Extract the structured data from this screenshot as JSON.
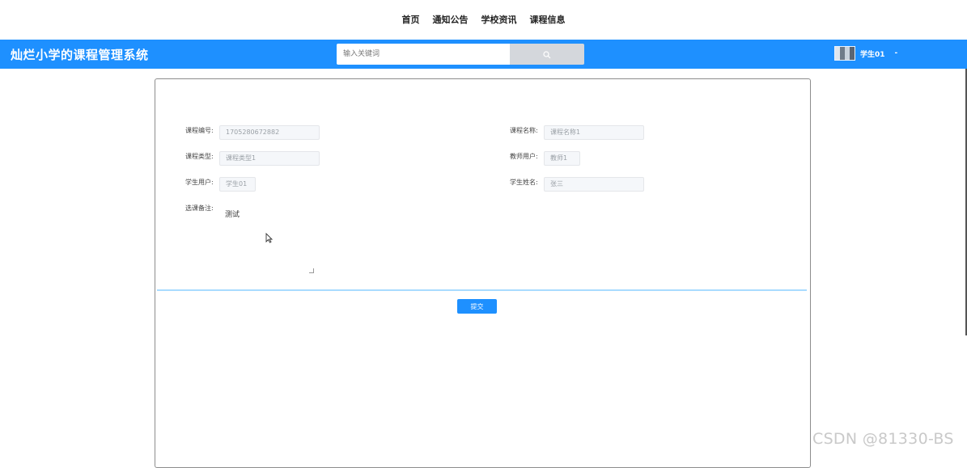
{
  "nav": {
    "items": [
      "首页",
      "通知公告",
      "学校资讯",
      "课程信息"
    ]
  },
  "header": {
    "title": "灿烂小学的课程管理系统",
    "search": {
      "placeholder": "输入关键词",
      "value": "",
      "icon": "search-icon"
    },
    "user": {
      "name": "学生01",
      "caret": "-",
      "avatar": "avatar-image"
    }
  },
  "form": {
    "course_no": {
      "label": "课程编号:",
      "value": "1705280672882"
    },
    "course_name": {
      "label": "课程名称:",
      "value": "课程名称1"
    },
    "course_type": {
      "label": "课程类型:",
      "value": "课程类型1"
    },
    "teacher_user": {
      "label": "教师用户:",
      "value": "教师1"
    },
    "student_user": {
      "label": "学生用户:",
      "value": "学生01"
    },
    "student_name": {
      "label": "学生姓名:",
      "value": "张三"
    },
    "remark": {
      "label": "选课备注:",
      "value": "测试"
    },
    "submit_label": "提交"
  },
  "watermark": "CSDN @81330-BS",
  "colors": {
    "primary": "#1e90ff",
    "divider": "#a9dbff",
    "search_button": "#d4d7dc"
  }
}
